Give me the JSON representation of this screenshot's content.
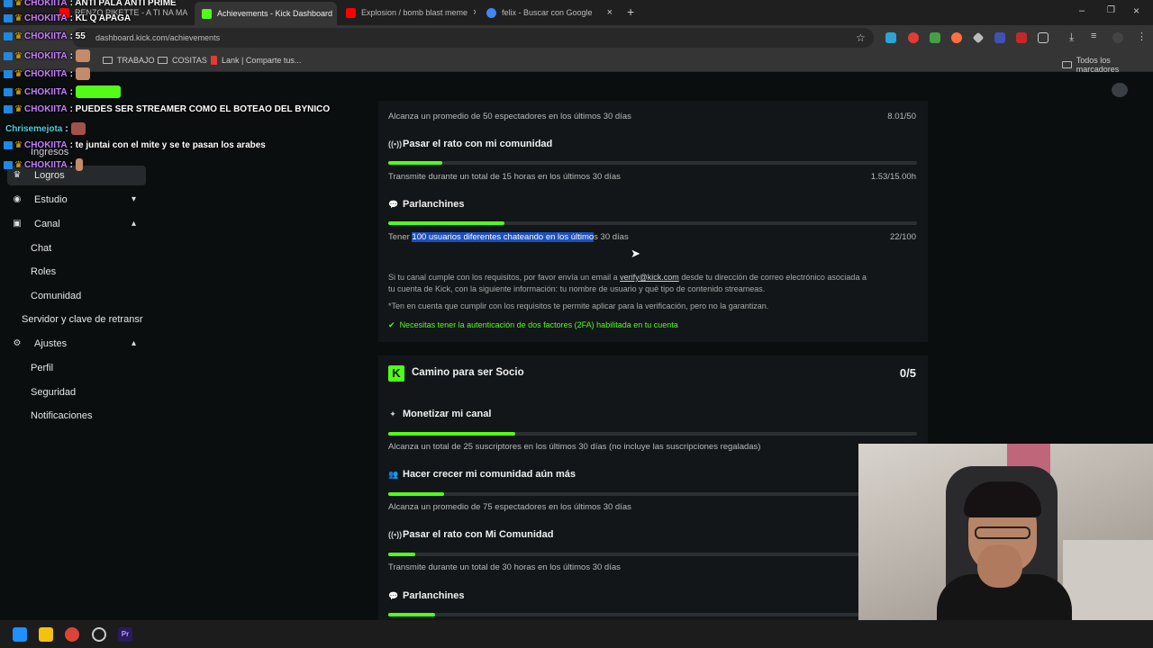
{
  "tabs": [
    {
      "label": "RENZO PIKETTE - A TI NA MA",
      "color": "#ff0000"
    },
    {
      "label": "Achievements - Kick Dashboard",
      "color": "#53fc18",
      "active": true
    },
    {
      "label": "Explosion / bomb blast meme",
      "color": "#ff0000"
    },
    {
      "label": "felix - Buscar con Google",
      "color": "#4285f4"
    }
  ],
  "new_tab_label": "+",
  "address": "dashboard.kick.com/achievements",
  "bookmarks": [
    "TRABAJO",
    "COSITAS",
    "Lank | Comparte tus...",
    "Todos los marcadores"
  ],
  "sidebar": {
    "logros": "Logros",
    "estudio": "Estudio",
    "canal": "Canal",
    "chat": "Chat",
    "roles": "Roles",
    "comunidad": "Comunidad",
    "servidor": "Servidor y clave de retransr",
    "ajustes": "Ajustes",
    "perfil": "Perfil",
    "seguridad": "Seguridad",
    "notificaciones": "Notificaciones",
    "ingresos": "Ingresos"
  },
  "verify": {
    "top_desc": "Alcanza un promedio de 50 espectadores en los últimos 30 días",
    "top_value": "8.01/50",
    "items": [
      {
        "title": "Pasar el rato con mi comunidad",
        "desc": "Transmite durante un total de 15 horas en los últimos 30 días",
        "value": "1.53/15.00h",
        "progress": 0.102
      },
      {
        "title": "Parlanchines",
        "desc_pre": "Tener ",
        "desc_sel": "100 usuarios diferentes chateando en los último",
        "desc_post": "s 30 días",
        "value": "22/100",
        "progress": 0.22
      }
    ],
    "note1": "Si tu canal cumple con los requisitos, por favor envía un email a",
    "email": "verify@kick.com",
    "note1b": "desde tu dirección de correo electrónico asociada a",
    "note2": "tu cuenta de Kick, con la siguiente información: tu nombre de usuario y qué tipo de contenido streameas.",
    "note3": "*Ten en cuenta que cumplir con los requisitos te permite aplicar para la verificación, pero no la garantizan.",
    "twofa": "Necesitas tener la autenticación de dos factores (2FA) habilitada en tu cuenta"
  },
  "partner": {
    "title": "Camino para ser Socio",
    "count": "0/5",
    "items": [
      {
        "title": "Monetizar mi canal",
        "desc": "Alcanza un total de 25 suscriptores en los últimos 30 días (no incluye las suscripciones regaladas)",
        "progress": 0.24
      },
      {
        "title": "Hacer crecer mi comunidad aún más",
        "desc": "Alcanza un promedio de 75 espectadores en los últimos 30 días",
        "progress": 0.106
      },
      {
        "title": "Pasar el rato con Mi Comunidad",
        "desc": "Transmite durante un total de 30 horas en los últimos 30 días",
        "progress": 0.051
      },
      {
        "title": "Parlanchines",
        "desc": "",
        "progress": 0.088
      }
    ]
  },
  "chat_overlay": [
    {
      "user": "CHOKIITA",
      "msg": ": ANTI PALA ANTI PRIME"
    },
    {
      "user": "CHOKIITA",
      "msg": ": KL Q APAGA"
    },
    {
      "user": "CHOKIITA",
      "msg": ": 55"
    },
    {
      "user": "CHOKIITA",
      "msg": ":"
    },
    {
      "user": "CHOKIITA",
      "msg": ":"
    },
    {
      "user": "CHOKIITA",
      "msg": ":"
    },
    {
      "user": "CHOKIITA",
      "msg": ": PUEDES SER STREAMER COMO EL BOTEAO DEL BYNICO"
    },
    {
      "user": "Chrisemejota",
      "msg": ":"
    },
    {
      "user": "CHOKIITA",
      "msg": ": te juntai con el mite y se te pasan los arabes"
    },
    {
      "user": "CHOKIITA",
      "msg": ":"
    }
  ],
  "colors": {
    "accent": "#53fc18",
    "bg": "#0b0e0f",
    "panel": "#121618",
    "selection": "#1b4fbf"
  }
}
